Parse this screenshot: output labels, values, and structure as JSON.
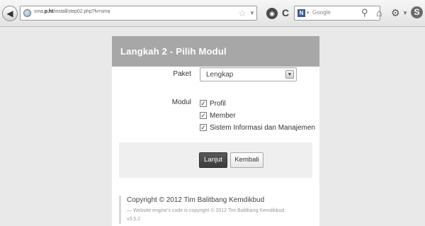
{
  "browser": {
    "url_prefix": "sma.",
    "url_host": "p.ht",
    "url_path": "/install/step02.php?lv=sma",
    "search_placeholder": "Google",
    "search_engine_letter": "N"
  },
  "panel": {
    "title": "Langkah 2 - Pilih Modul"
  },
  "form": {
    "paket_label": "Paket",
    "paket_value": "Lengkap",
    "modul_label": "Modul",
    "modules": [
      {
        "label": "Profil",
        "checked": true
      },
      {
        "label": "Member",
        "checked": true
      },
      {
        "label": "Sistem Informasi dan Manajemen",
        "checked": true
      }
    ]
  },
  "actions": {
    "next_label": "Lanjut",
    "back_label": "Kembali"
  },
  "footer": {
    "copyright": "Copyright © 2012 Tim Balitbang Kemdikbud",
    "engine_note": "— Website engine's code is copyright © 2012 Tim Balitbang Kemdikbud",
    "version": "v3.5.2"
  }
}
